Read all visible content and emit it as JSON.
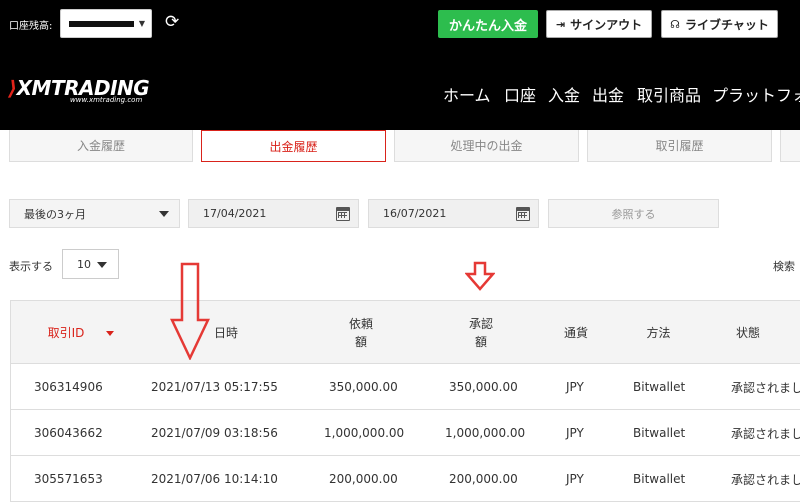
{
  "topbar": {
    "account_label": "口座残高:",
    "deposit_button": "かんたん入金",
    "signout_button": "サインアウト",
    "livechat_button": "ライブチャット"
  },
  "nav": {
    "logo": "XMTRADING",
    "logo_sub": "www.xmtrading.com",
    "items": [
      "ホーム",
      "口座",
      "入金",
      "出金",
      "取引商品",
      "プラットフォ"
    ]
  },
  "tabs": [
    {
      "label": "入金履歴",
      "active": false
    },
    {
      "label": "出金履歴",
      "active": true
    },
    {
      "label": "処理中の出金",
      "active": false
    },
    {
      "label": "取引履歴",
      "active": false
    }
  ],
  "filters": {
    "period": "最後の3ヶ月",
    "date_from": "17/04/2021",
    "date_to": "16/07/2021",
    "browse_button": "参照する"
  },
  "list": {
    "show_label": "表示する",
    "page_size": "10",
    "search_label": "検索"
  },
  "table": {
    "headers": [
      "取引ID",
      "日時",
      "依頼\n額",
      "承認\n額",
      "通貨",
      "方法",
      "状態"
    ],
    "rows": [
      {
        "id": "306314906",
        "datetime": "2021/07/13 05:17:55",
        "requested": "350,000.00",
        "approved": "350,000.00",
        "currency": "JPY",
        "method": "Bitwallet",
        "status": "承認されまし"
      },
      {
        "id": "306043662",
        "datetime": "2021/07/09 03:18:56",
        "requested": "1,000,000.00",
        "approved": "1,000,000.00",
        "currency": "JPY",
        "method": "Bitwallet",
        "status": "承認されまし"
      },
      {
        "id": "305571653",
        "datetime": "2021/07/06 10:14:10",
        "requested": "200,000.00",
        "approved": "200,000.00",
        "currency": "JPY",
        "method": "Bitwallet",
        "status": "承認されまし"
      }
    ]
  },
  "colors": {
    "accent_red": "#d9231b",
    "deposit_green": "#2dbd4e",
    "annotation_arrow": "#e53935"
  }
}
